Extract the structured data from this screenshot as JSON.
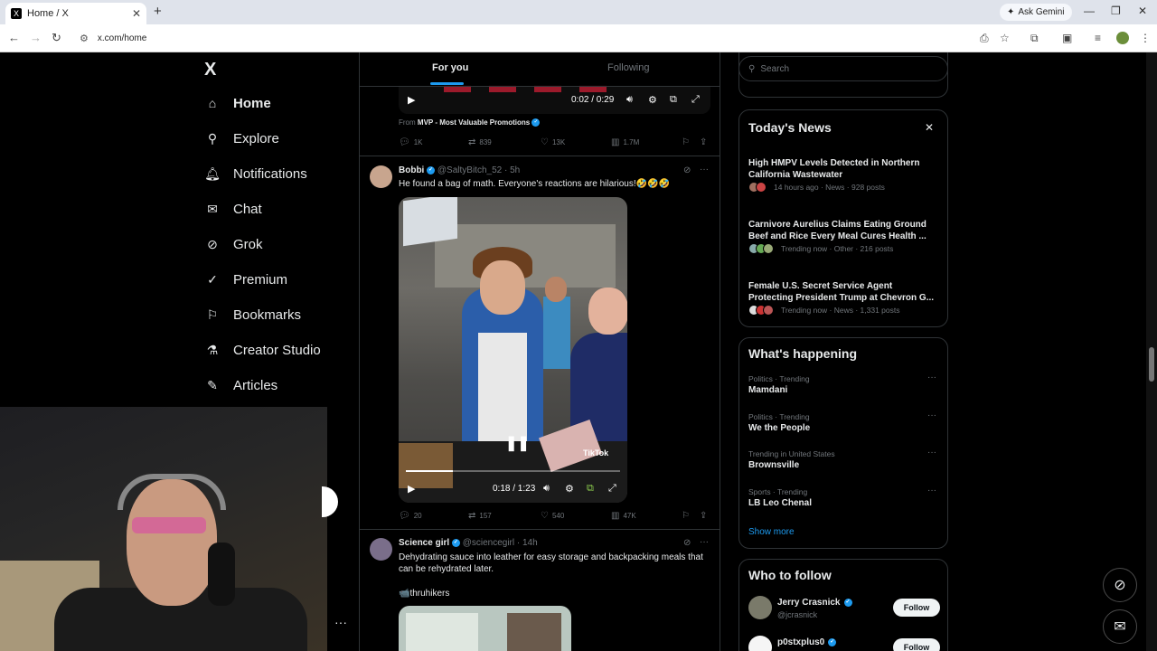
{
  "browser": {
    "tab_title": "Home / X",
    "tab_favicon": "X",
    "gemini_label": "Ask Gemini",
    "url": "x.com/home"
  },
  "nav": {
    "logo": "X",
    "items": [
      {
        "label": "Home",
        "icon": "home-icon",
        "glyph": "⌂"
      },
      {
        "label": "Explore",
        "icon": "search-icon",
        "glyph": "⚲"
      },
      {
        "label": "Notifications",
        "icon": "bell-icon",
        "glyph": "🔔︎"
      },
      {
        "label": "Chat",
        "icon": "mail-icon",
        "glyph": "✉"
      },
      {
        "label": "Grok",
        "icon": "grok-icon",
        "glyph": "⊘"
      },
      {
        "label": "Premium",
        "icon": "verified-icon",
        "glyph": "✓"
      },
      {
        "label": "Bookmarks",
        "icon": "bookmark-icon",
        "glyph": "⚐"
      },
      {
        "label": "Creator Studio",
        "icon": "flask-icon",
        "glyph": "⚗"
      },
      {
        "label": "Articles",
        "icon": "article-icon",
        "glyph": "✎"
      }
    ],
    "more": "···"
  },
  "timeline": {
    "tab_for_you": "For you",
    "tab_following": "Following",
    "post1": {
      "video_time": "0:02 / 0:29",
      "from_prefix": "From",
      "from_name": "MVP - Most Valuable Promotions",
      "replies": "1K",
      "reposts": "839",
      "likes": "13K",
      "views": "1.7M"
    },
    "post2": {
      "name": "Bobbi",
      "handle": "@SaltyBitch_52",
      "time": "· 5h",
      "text": "He found a bag of math. Everyone's reactions are hilarious!🤣🤣🤣",
      "video_time": "0:18 / 1:23",
      "video_progress": 0.22,
      "watermark": "TikTok",
      "replies": "20",
      "reposts": "157",
      "likes": "540",
      "views": "47K"
    },
    "post3": {
      "name": "Science girl",
      "handle": "@sciencegirl",
      "time": "· 14h",
      "text": "Dehydrating sauce into leather for easy storage and backpacking meals that can be rehydrated later.",
      "hashtag": "📹thruhikers"
    }
  },
  "sidebar": {
    "search_placeholder": "Search",
    "news": {
      "title": "Today's News",
      "items": [
        {
          "title": "High HMPV Levels Detected in Northern California Wastewater",
          "meta": "14 hours ago · News · 928 posts"
        },
        {
          "title": "Carnivore Aurelius Claims Eating Ground Beef and Rice Every Meal Cures Health ...",
          "meta": "Trending now · Other · 216 posts"
        },
        {
          "title": "Female U.S. Secret Service Agent Protecting President Trump at Chevron G...",
          "meta": "Trending now · News · 1,331 posts"
        }
      ]
    },
    "happening": {
      "title": "What's happening",
      "items": [
        {
          "context": "Politics · Trending",
          "name": "Mamdani"
        },
        {
          "context": "Politics · Trending",
          "name": "We the People"
        },
        {
          "context": "Trending in United States",
          "name": "Brownsville"
        },
        {
          "context": "Sports · Trending",
          "name": "LB Leo Chenal"
        }
      ],
      "show_more": "Show more"
    },
    "who_to_follow": {
      "title": "Who to follow",
      "items": [
        {
          "name": "Jerry Crasnick",
          "handle": "@jcrasnick",
          "button": "Follow"
        },
        {
          "name": "p0stxplus0",
          "handle": "",
          "button": "Follow"
        }
      ]
    }
  },
  "colors": {
    "accent": "#1d9bf0",
    "background": "#000000",
    "border": "#2f3336",
    "muted": "#71767b"
  }
}
